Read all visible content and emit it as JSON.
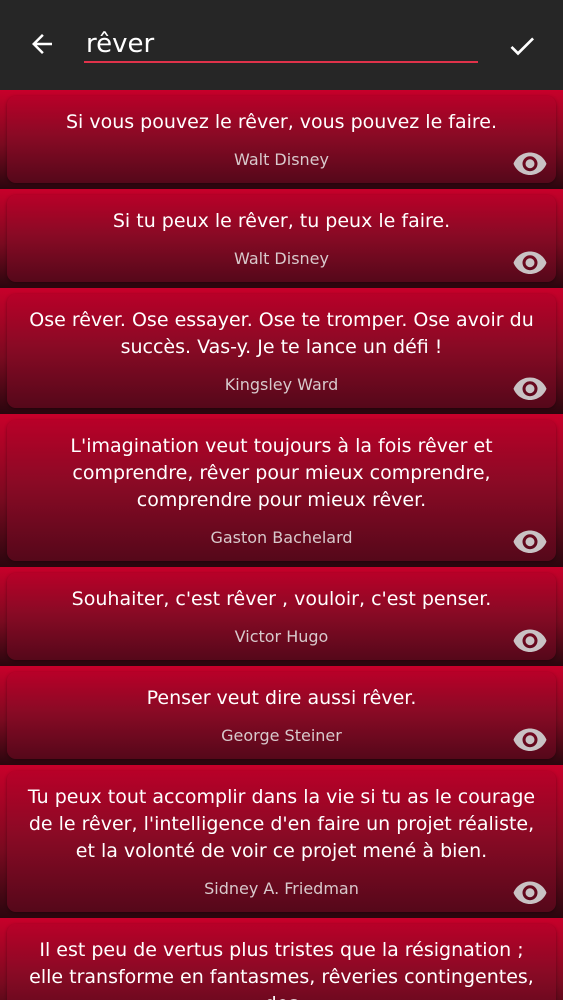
{
  "toolbar": {
    "search_value": "rêver",
    "back_icon": "arrow-left-icon",
    "confirm_icon": "check-icon"
  },
  "colors": {
    "toolbar_bg": "#262626",
    "accent_underline": "#e0324a",
    "card_top": "#b80028",
    "card_bottom": "#55081a",
    "author_text": "#d8c9cc",
    "eye_icon": "#c9c2c4"
  },
  "quotes": [
    {
      "text": "Si vous pouvez le rêver, vous pouvez le faire.",
      "author": "Walt Disney"
    },
    {
      "text": "Si tu peux le rêver, tu peux le faire.",
      "author": "Walt Disney"
    },
    {
      "text": "Ose rêver. Ose essayer. Ose te tromper. Ose avoir du succès. Vas-y. Je te lance un défi !",
      "author": "Kingsley Ward"
    },
    {
      "text": "L'imagination veut toujours à la fois rêver et comprendre, rêver pour mieux comprendre, comprendre pour mieux rêver.",
      "author": "Gaston Bachelard"
    },
    {
      "text": "Souhaiter, c'est rêver , vouloir, c'est penser.",
      "author": "Victor Hugo"
    },
    {
      "text": "Penser veut dire aussi rêver.",
      "author": "George Steiner"
    },
    {
      "text": "Tu peux tout accomplir dans la vie si tu as le courage de le rêver, l'intelligence d'en faire un projet réaliste, et la volonté de voir ce projet mené à bien.",
      "author": "Sidney A. Friedman"
    },
    {
      "text": "Il est peu de vertus plus tristes que la résignation ; elle transforme en fantasmes, rêveries contingentes, des",
      "author": ""
    }
  ]
}
